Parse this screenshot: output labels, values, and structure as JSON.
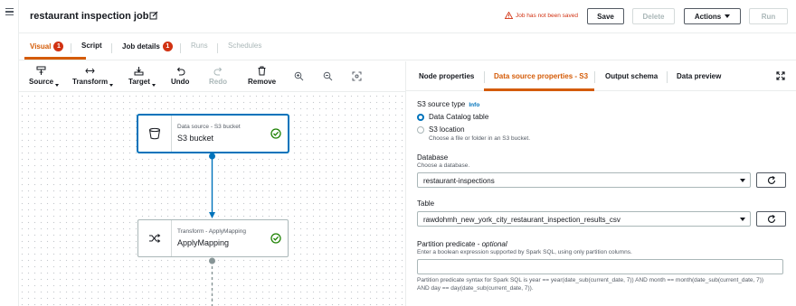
{
  "header": {
    "job_title": "restaurant inspection job",
    "warning": "Job has not been saved",
    "save_label": "Save",
    "delete_label": "Delete",
    "actions_label": "Actions",
    "run_label": "Run"
  },
  "tabs": [
    {
      "label": "Visual",
      "badge": "1"
    },
    {
      "label": "Script"
    },
    {
      "label": "Job details",
      "badge": "1"
    },
    {
      "label": "Runs"
    },
    {
      "label": "Schedules"
    }
  ],
  "toolbar": {
    "source": "Source",
    "transform": "Transform",
    "target": "Target",
    "undo": "Undo",
    "redo": "Redo",
    "remove": "Remove"
  },
  "nodes": {
    "s3": {
      "subtitle": "Data source - S3 bucket",
      "name": "S3 bucket"
    },
    "apply": {
      "subtitle": "Transform - ApplyMapping",
      "name": "ApplyMapping"
    }
  },
  "panel": {
    "tabs": [
      "Node properties",
      "Data source properties - S3",
      "Output schema",
      "Data preview"
    ],
    "source_type_label": "S3 source type",
    "info": "Info",
    "option_catalog": "Data Catalog table",
    "option_location": "S3 location",
    "option_location_desc": "Choose a file or folder in an S3 bucket.",
    "database_label": "Database",
    "database_desc": "Choose a database.",
    "database_value": "restaurant-inspections",
    "table_label": "Table",
    "table_value": "rawdohmh_new_york_city_restaurant_inspection_results_csv",
    "partition_label": "Partition predicate",
    "partition_optional": "optional",
    "partition_desc": "Enter a boolean expression supported by Spark SQL, using only partition columns.",
    "partition_hint_1": "Partition predicate syntax for Spark SQL is year == year(date_sub(current_date, 7)) AND month == month(date_sub(current_date, 7))",
    "partition_hint_2": "AND day == day(date_sub(current_date, 7))."
  },
  "colors": {
    "accent": "#d45b07",
    "link": "#0073bb",
    "error": "#d13212",
    "success": "#1d8102"
  }
}
